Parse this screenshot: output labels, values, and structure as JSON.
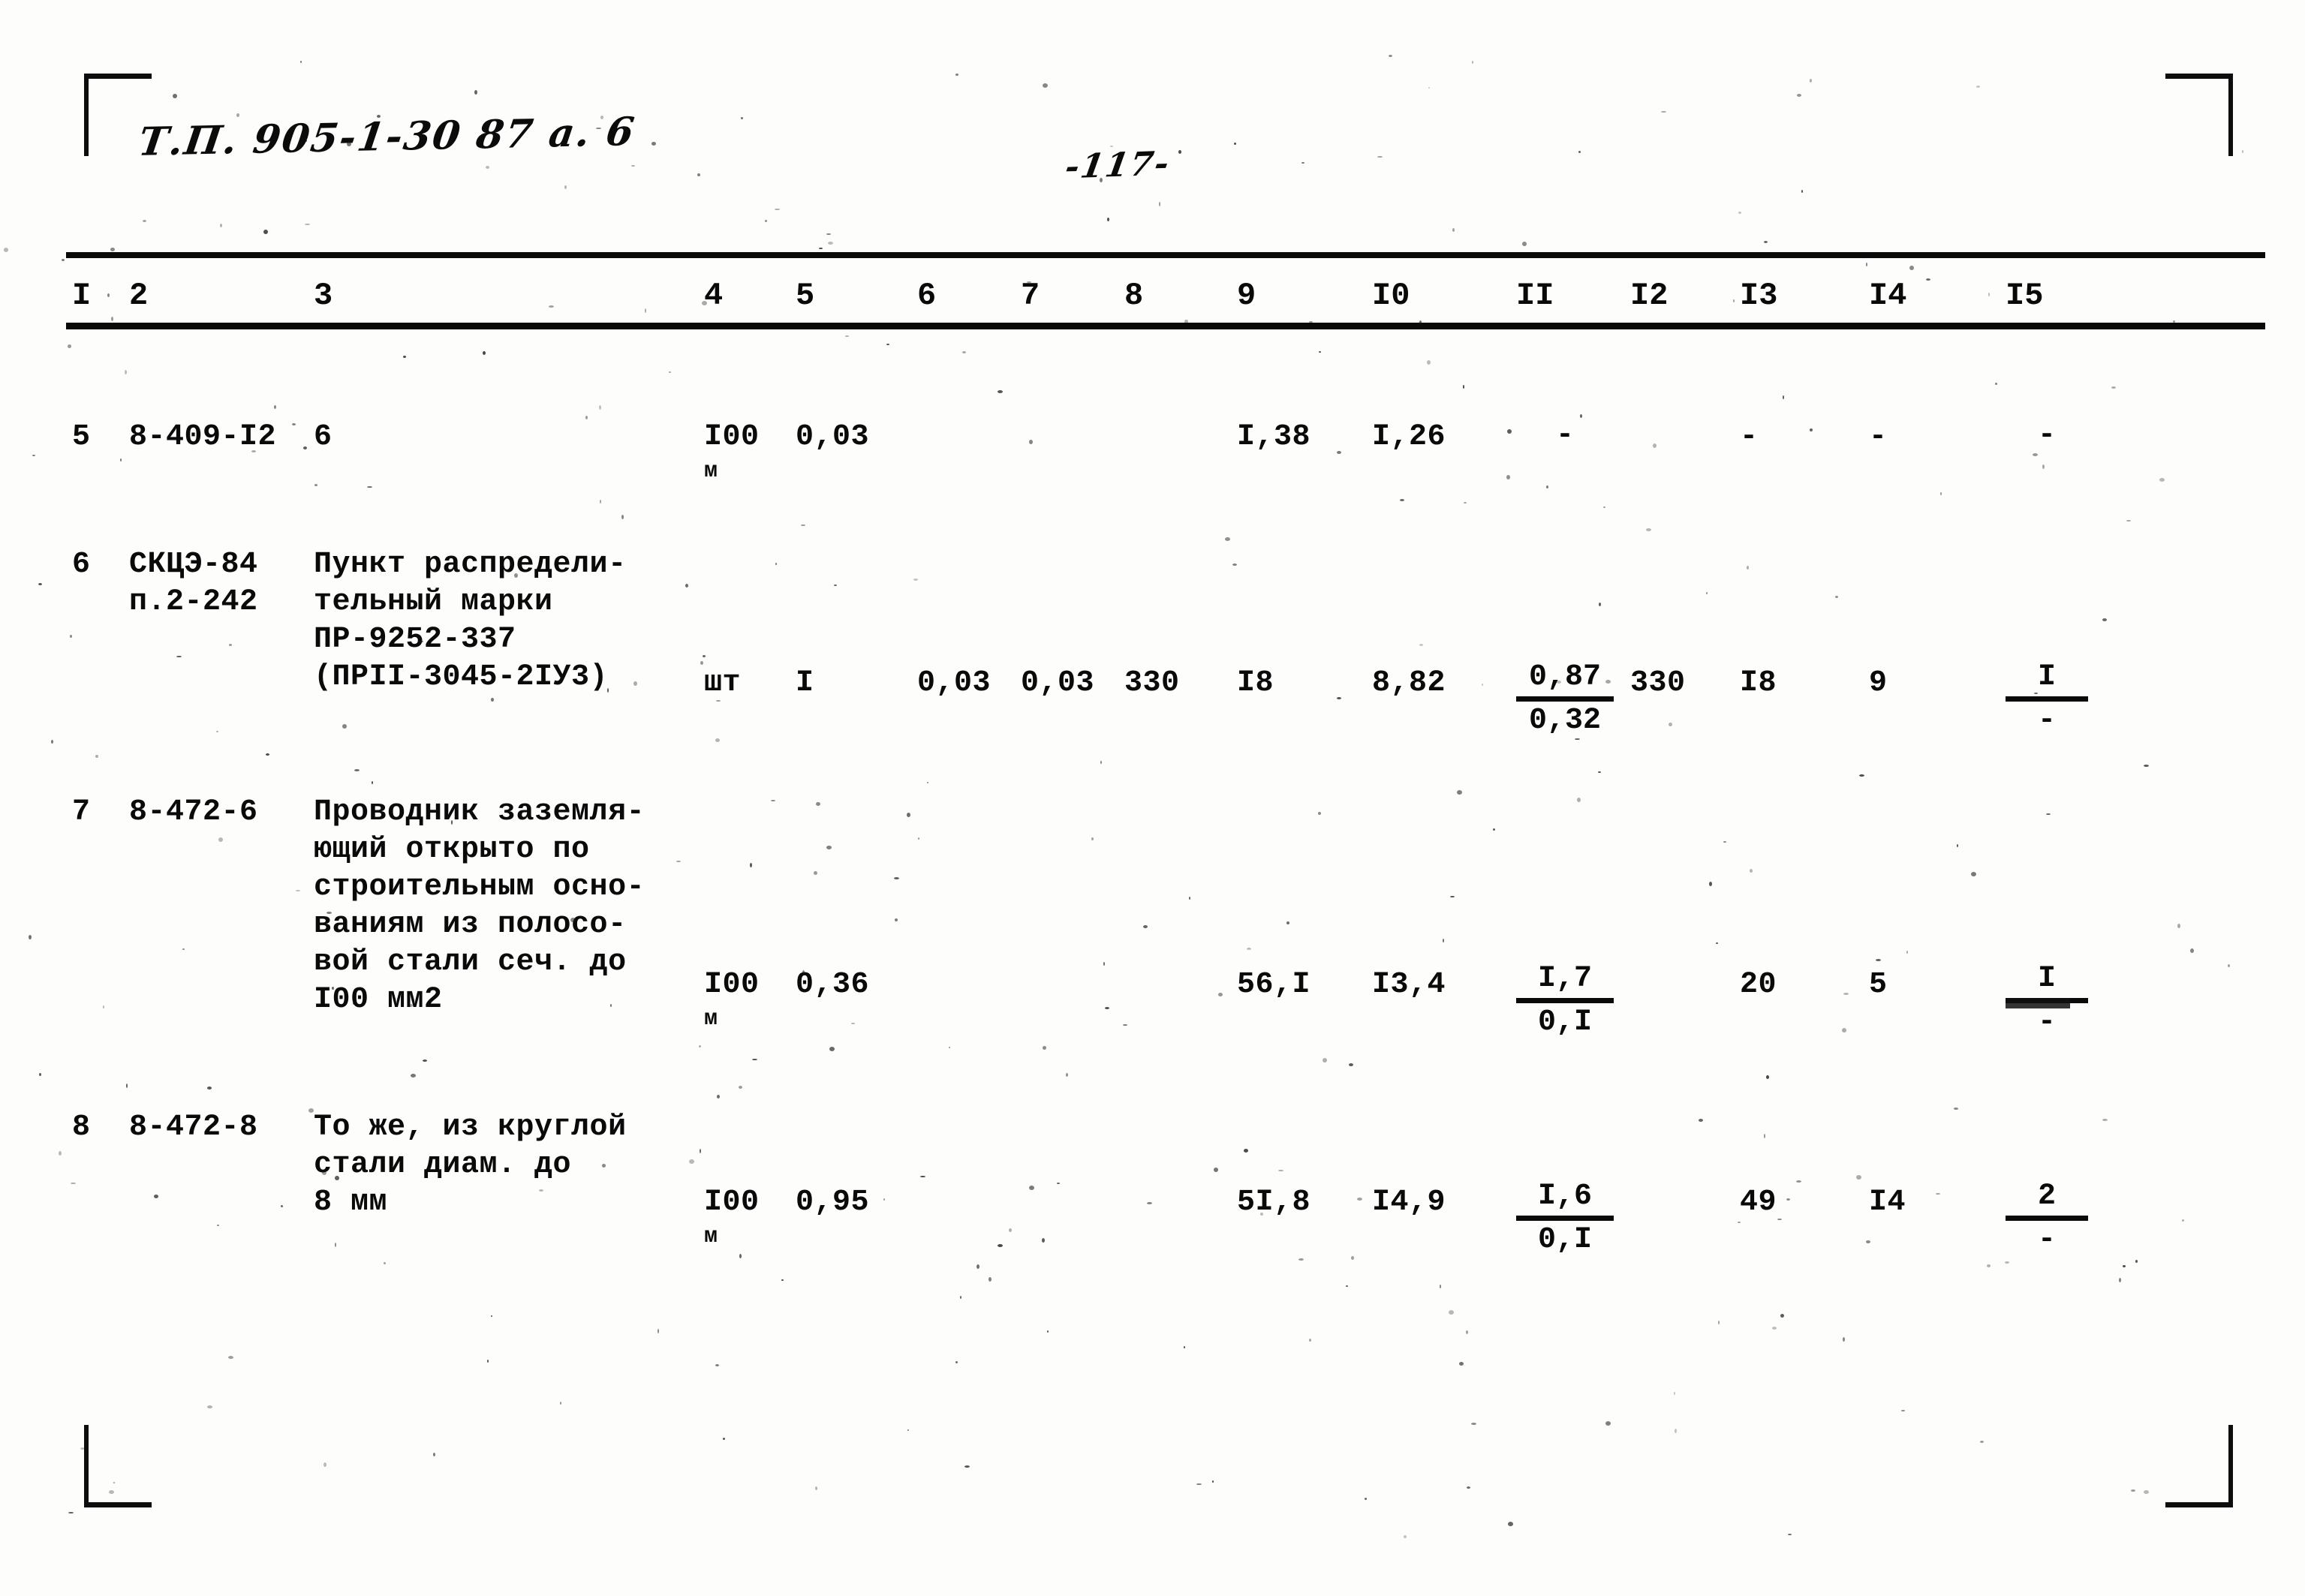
{
  "document": {
    "handwritten_code": "Т.П. 905-1-30 87    а. 6",
    "handwritten_page": "-117-"
  },
  "table": {
    "column_numbers": [
      "I",
      "2",
      "3",
      "4",
      "5",
      "6",
      "7",
      "8",
      "9",
      "I0",
      "II",
      "I2",
      "I3",
      "I4",
      "I5"
    ],
    "rows": [
      {
        "c1": "5",
        "c2": "8-409-I2",
        "c3": "6",
        "c4": "I00",
        "c4_sub": "м",
        "c5": "0,03",
        "c6": "",
        "c7": "",
        "c8": "",
        "c9": "I,38",
        "c10": "I,26",
        "c11_num": "-",
        "c11_den": "",
        "c12": "",
        "c13": "-",
        "c14": "-",
        "c15_num": "-",
        "c15_den": ""
      },
      {
        "c1": "6",
        "c2": "СКЦЭ-84\nп.2-242",
        "c3": "Пункт распредели-\nтельный марки\nПР-9252-337\n(ПРII-3045-2IУ3)",
        "c4": "шт",
        "c4_sub": "",
        "c5": "I",
        "c6": "0,03",
        "c7": "0,03",
        "c8": "330",
        "c9": "I8",
        "c10": "8,82",
        "c11_num": "0,87",
        "c11_den": "0,32",
        "c12": "330",
        "c13": "I8",
        "c14": "9",
        "c15_num": "I",
        "c15_den": "-"
      },
      {
        "c1": "7",
        "c2": "8-472-6",
        "c3": "Проводник заземля-\nющий открыто по\nстроительным осно-\nваниям из полосо-\nвой стали сеч. до\nI00 мм2",
        "c4": "I00",
        "c4_sub": "м",
        "c5": "0,36",
        "c6": "",
        "c7": "",
        "c8": "",
        "c9": "56,I",
        "c10": "I3,4",
        "c11_num": "I,7",
        "c11_den": "0,I",
        "c12": "",
        "c13": "20",
        "c14": "5",
        "c15_num": "I",
        "c15_den": "-"
      },
      {
        "c1": "8",
        "c2": "8-472-8",
        "c3": "То же, из круглой\nстали диам. до\n8 мм",
        "c4": "I00",
        "c4_sub": "м",
        "c5": "0,95",
        "c6": "",
        "c7": "",
        "c8": "",
        "c9": "5I,8",
        "c10": "I4,9",
        "c11_num": "I,6",
        "c11_den": "0,I",
        "c12": "",
        "c13": "49",
        "c14": "I4",
        "c15_num": "2",
        "c15_den": "-"
      }
    ]
  }
}
